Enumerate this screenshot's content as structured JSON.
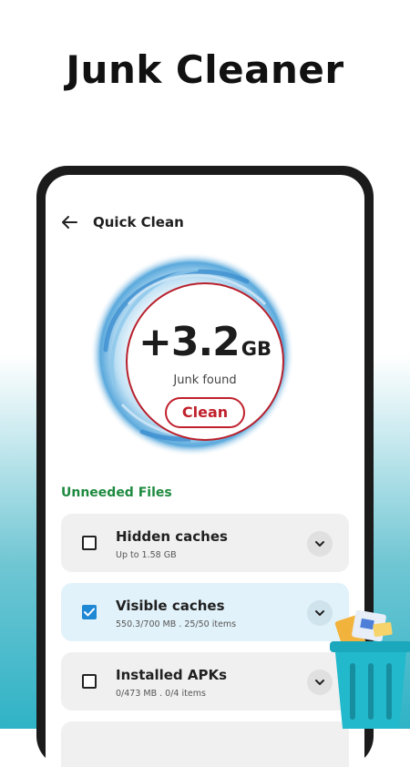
{
  "headline": "Junk Cleaner",
  "topbar": {
    "title": "Quick Clean",
    "back_icon": "arrow-left-icon"
  },
  "summary": {
    "amount": "+3.2",
    "unit": "GB",
    "label": "Junk found",
    "clean_label": "Clean"
  },
  "section_title": "Unneeded Files",
  "items": [
    {
      "title": "Hidden caches",
      "subtitle": "Up to 1.58 GB",
      "checked": false
    },
    {
      "title": "Visible caches",
      "subtitle": "550.3/700 MB . 25/50 items",
      "checked": true
    },
    {
      "title": "Installed APKs",
      "subtitle": "0/473 MB . 0/4 items",
      "checked": false
    }
  ],
  "colors": {
    "accent_red": "#c0202c",
    "section_green": "#1e8a3f",
    "checkbox_blue": "#1e88d4",
    "trash_teal": "#1bb0c4"
  }
}
